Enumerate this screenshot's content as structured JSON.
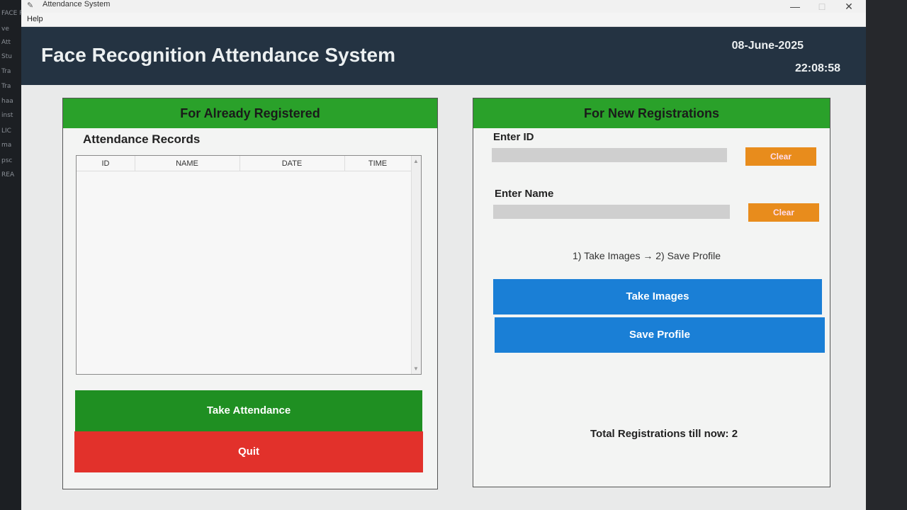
{
  "window": {
    "title": "Attendance System",
    "menu_help": "Help",
    "minimize": "—",
    "maximize": "□",
    "close": "✕"
  },
  "background_editor": {
    "items": [
      "FACE R",
      "ve",
      "Att",
      "Stu",
      "Tra",
      "Tra",
      "haa",
      "inst",
      "LIC",
      "ma",
      "psc",
      "REA"
    ]
  },
  "header": {
    "title": "Face Recognition Attendance System",
    "date": "08-June-2025",
    "time": "22:08:58"
  },
  "left_panel": {
    "header": "For Already Registered",
    "records_title": "Attendance Records",
    "columns": [
      "ID",
      "NAME",
      "DATE",
      "TIME"
    ],
    "rows": [],
    "take_attendance": "Take Attendance",
    "quit": "Quit"
  },
  "right_panel": {
    "header": "For New Registrations",
    "id_label": "Enter ID",
    "id_value": "",
    "name_label": "Enter Name",
    "name_value": "",
    "clear_label": "Clear",
    "instructions": "1) Take Images  →  2) Save Profile",
    "take_images": "Take Images",
    "save_profile": "Save Profile",
    "total": "Total Registrations till now: 2"
  },
  "colors": {
    "header_bg": "#243342",
    "green": "#2aa12a",
    "red": "#e2312b",
    "blue": "#1a7fd6",
    "orange": "#e88c1c"
  }
}
